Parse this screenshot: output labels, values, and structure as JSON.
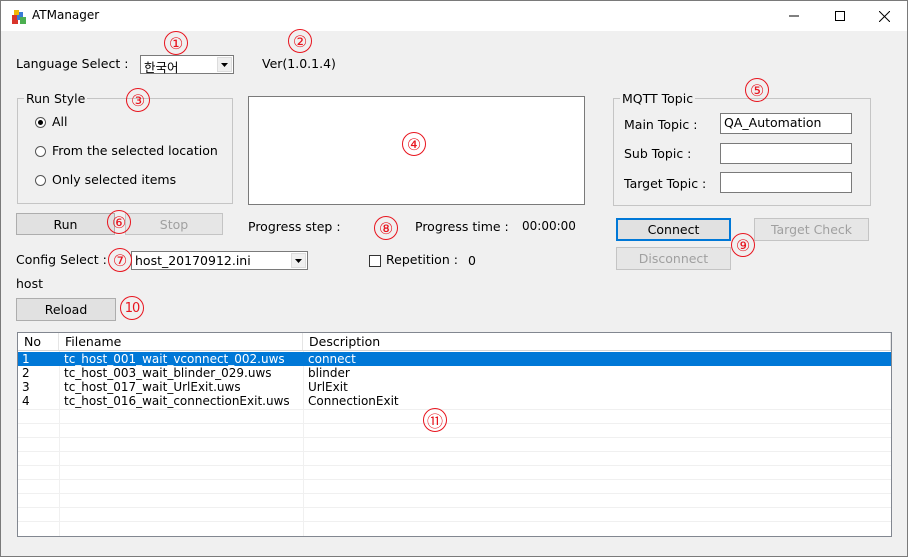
{
  "window": {
    "title": "ATManager"
  },
  "language": {
    "label": "Language Select :",
    "value": "한국어"
  },
  "version": "Ver(1.0.1.4)",
  "run_style": {
    "legend": "Run Style",
    "options": [
      {
        "label": "All",
        "checked": true
      },
      {
        "label": "From the selected location",
        "checked": false
      },
      {
        "label": "Only selected items",
        "checked": false
      }
    ]
  },
  "mqtt": {
    "legend": "MQTT Topic",
    "main_label": "Main Topic :",
    "main_value": "QA_Automation",
    "sub_label": "Sub Topic :",
    "sub_value": "",
    "target_label": "Target Topic :",
    "target_value": ""
  },
  "buttons": {
    "run": "Run",
    "stop": "Stop",
    "connect": "Connect",
    "target_check": "Target Check",
    "disconnect": "Disconnect",
    "reload": "Reload"
  },
  "progress": {
    "step_label": "Progress step :",
    "time_label": "Progress time :",
    "time_value": "00:00:00"
  },
  "config": {
    "label": "Config Select :",
    "value": "host_20170912.ini",
    "host": "host"
  },
  "repetition": {
    "label": "Repetition :",
    "value": "0",
    "checked": false
  },
  "markers": [
    "①",
    "②",
    "③",
    "④",
    "⑤",
    "⑥",
    "⑦",
    "⑧",
    "⑨",
    "10",
    "⑪"
  ],
  "table": {
    "columns": [
      "No",
      "Filename",
      "Description"
    ],
    "rows": [
      {
        "no": "1",
        "filename": "tc_host_001_wait_vconnect_002.uws",
        "description": "connect",
        "selected": true
      },
      {
        "no": "2",
        "filename": "tc_host_003_wait_blinder_029.uws",
        "description": "blinder",
        "selected": false
      },
      {
        "no": "3",
        "filename": "tc_host_017_wait_UrlExit.uws",
        "description": "UrlExit",
        "selected": false
      },
      {
        "no": "4",
        "filename": "tc_host_016_wait_connectionExit.uws",
        "description": "ConnectionExit",
        "selected": false
      }
    ]
  },
  "colors": {
    "selection": "#0078d7",
    "marker": "#e8141e"
  }
}
